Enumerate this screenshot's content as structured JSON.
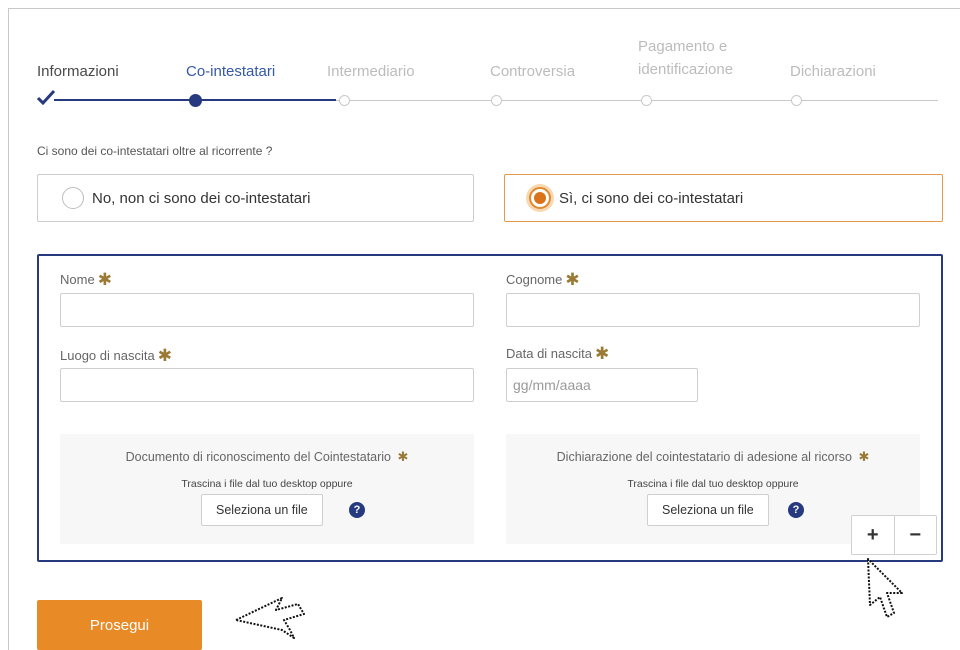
{
  "stepper": {
    "steps": [
      {
        "label": "Informazioni",
        "state": "done"
      },
      {
        "label": "Co-intestatari",
        "state": "active"
      },
      {
        "label": "Intermediario",
        "state": "future"
      },
      {
        "label": "Controversia",
        "state": "future"
      },
      {
        "label_line1": "Pagamento e",
        "label_line2": "identificazione",
        "state": "future"
      },
      {
        "label": "Dichiarazioni",
        "state": "future"
      }
    ]
  },
  "question": "Ci sono dei co-intestatari oltre al ricorrente ?",
  "options": [
    {
      "label": "No, non ci sono dei co-intestatari",
      "selected": false
    },
    {
      "label": "Sì, ci sono dei co-intestatari",
      "selected": true
    }
  ],
  "form": {
    "nome_label": "Nome",
    "cognome_label": "Cognome",
    "luogo_label": "Luogo di nascita",
    "data_label": "Data di nascita",
    "data_placeholder": "gg/mm/aaaa",
    "nome_value": "",
    "cognome_value": "",
    "luogo_value": ""
  },
  "uploads": [
    {
      "title": "Documento di riconoscimento del Cointestatario",
      "sub": "Trascina i file dal tuo desktop oppure",
      "button": "Seleziona un file"
    },
    {
      "title": "Dichiarazione del cointestatario di adesione al ricorso",
      "sub": "Trascina i file dal tuo desktop oppure",
      "button": "Seleziona un file"
    }
  ],
  "controls": {
    "plus": "+",
    "minus": "−",
    "help": "?"
  },
  "submit_label": "Prosegui",
  "colors": {
    "accent_blue": "#27397f",
    "accent_orange": "#e88a26",
    "star": "#9a7a35"
  },
  "icons": [
    "check-icon",
    "help-icon",
    "pointer-cursor-icon"
  ]
}
